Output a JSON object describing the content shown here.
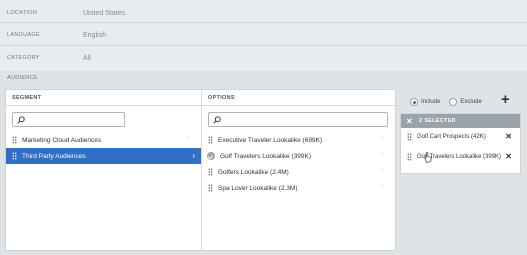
{
  "fields": [
    {
      "label": "LOCATION",
      "value": "United States"
    },
    {
      "label": "LANGUAGE",
      "value": "English"
    },
    {
      "label": "CATEGORY",
      "value": "All"
    }
  ],
  "audience": {
    "label": "AUDIENCE",
    "segment": {
      "header": "SEGMENT",
      "search_placeholder": "",
      "items": [
        {
          "label": "Marketing Cloud Audiences"
        },
        {
          "label": "Third Party Audiences"
        }
      ]
    },
    "options": {
      "header": "OPTIONS",
      "search_placeholder": "",
      "items": [
        {
          "label": "Executive Traveler Lookalike (699K)"
        },
        {
          "label": "Golf Travelers Lookalike (399K)"
        },
        {
          "label": "Golfers Lookalike (2.4M)"
        },
        {
          "label": "Spa Lover Lookalike (2.3M)"
        }
      ]
    },
    "mode": {
      "include_label": "Include",
      "exclude_label": "Exclude",
      "selected": "Include"
    },
    "selected": {
      "header": "2 SELECTED",
      "items": [
        {
          "label": "Golf Cart Prospects (42K)"
        },
        {
          "label": "Golf Travelers Lookalike (399K)"
        }
      ]
    }
  },
  "colors": {
    "accent": "#2f6fc6",
    "selected_header": "#9aa3a9",
    "background": "#dfe3e6"
  },
  "icons": {
    "search": "search-icon",
    "grip": "drag-handle-icon",
    "check": "check-circle-icon",
    "star": "star-icon",
    "close": "close-icon",
    "add": "plus-icon",
    "chevron": "chevron-right-icon"
  }
}
